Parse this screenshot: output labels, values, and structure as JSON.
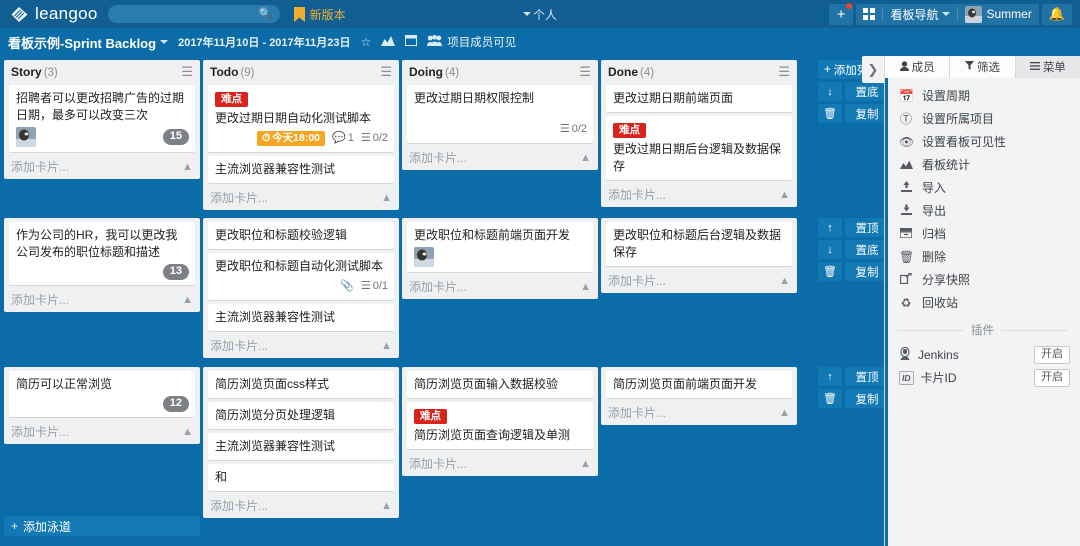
{
  "topbar": {
    "brand": "leangoo",
    "search_placeholder": "",
    "search_value": "",
    "new_version_label": "新版本",
    "center_tab": "个人",
    "add_label": "+",
    "nav_label": "看板导航",
    "user_name": "Summer",
    "bell_icon": "bell-icon"
  },
  "boardbar": {
    "title": "看板示例-Sprint Backlog",
    "dates": "2017年11月10日 - 2017年11月23日",
    "star_icon": "star-icon",
    "chart_icon": "chart-icon",
    "collapse_icon": "minimize-icon",
    "visibility_icon": "team-icon",
    "visibility": "项目成员可见"
  },
  "board": {
    "add_list_label": "添加列表",
    "add_lane_label": "添加泳道",
    "collapse_handle_icon": "chevron-right-icon",
    "rail": {
      "top_label": "置顶",
      "bottom_label": "置底",
      "copy_label": "复制",
      "up_icon": "arrow-up-icon",
      "down_icon": "arrow-down-icon",
      "trash_icon": "trash-icon"
    },
    "add_card_label": "添加卡片...",
    "columns": [
      {
        "title": "Story",
        "count": "(3)"
      },
      {
        "title": "Todo",
        "count": "(9)"
      },
      {
        "title": "Doing",
        "count": "(4)"
      },
      {
        "title": "Done",
        "count": "(4)"
      }
    ],
    "lanes": [
      {
        "columns": [
          {
            "cards": [
              {
                "text": "招聘者可以更改招聘广告的过期日期，最多可以改变三次",
                "avatar": true,
                "points": "15"
              }
            ]
          },
          {
            "cards": [
              {
                "tag": "难点",
                "text": "更改过期日期自动化测试脚本",
                "due": "今天18:00",
                "comments": "1",
                "checklist": "0/2"
              },
              {
                "text": "主流浏览器兼容性测试"
              }
            ]
          },
          {
            "cards": [
              {
                "text": "更改过期日期权限控制",
                "checklist": "0/2"
              }
            ]
          },
          {
            "cards": [
              {
                "text": "更改过期日期前端页面"
              },
              {
                "tag": "难点",
                "text": "更改过期日期后台逻辑及数据保存"
              }
            ]
          }
        ]
      },
      {
        "columns": [
          {
            "cards": [
              {
                "text": "作为公司的HR，我可以更改我公司发布的职位标题和描述",
                "points": "13"
              }
            ]
          },
          {
            "cards": [
              {
                "text": "更改职位和标题校验逻辑"
              },
              {
                "text": "更改职位和标题自动化测试脚本",
                "attachment": true,
                "checklist": "0/1"
              },
              {
                "text": "主流浏览器兼容性测试"
              }
            ]
          },
          {
            "cards": [
              {
                "text": "更改职位和标题前端页面开发",
                "avatar": true
              }
            ]
          },
          {
            "cards": [
              {
                "text": "更改职位和标题后台逻辑及数据保存"
              }
            ]
          }
        ]
      },
      {
        "columns": [
          {
            "cards": [
              {
                "text": "简历可以正常浏览",
                "points": "12"
              }
            ]
          },
          {
            "cards": [
              {
                "text": "简历浏览页面css样式"
              },
              {
                "text": "简历浏览分页处理逻辑"
              },
              {
                "text": "主流浏览器兼容性测试"
              },
              {
                "text": "和"
              }
            ]
          },
          {
            "cards": [
              {
                "text": "简历浏览页面输入数据校验"
              },
              {
                "tag": "难点",
                "text": "简历浏览页面查询逻辑及单测"
              }
            ]
          },
          {
            "cards": [
              {
                "text": "简历浏览页面前端页面开发"
              }
            ]
          }
        ]
      }
    ]
  },
  "right_panel": {
    "tabs": [
      {
        "label": "成员",
        "icon": "user-icon"
      },
      {
        "label": "筛选",
        "icon": "filter-icon"
      },
      {
        "label": "菜单",
        "icon": "hamburger-icon"
      }
    ],
    "menu": [
      {
        "label": "设置周期",
        "icon": "calendar-icon"
      },
      {
        "label": "设置所属项目",
        "icon": "project-icon"
      },
      {
        "label": "设置看板可见性",
        "icon": "eye-icon"
      },
      {
        "label": "看板统计",
        "icon": "chart-icon"
      },
      {
        "label": "导入",
        "icon": "import-icon"
      },
      {
        "label": "导出",
        "icon": "export-icon"
      },
      {
        "label": "归档",
        "icon": "archive-icon"
      },
      {
        "label": "删除",
        "icon": "trash-icon"
      },
      {
        "label": "分享快照",
        "icon": "share-icon"
      },
      {
        "label": "回收站",
        "icon": "recycle-icon"
      }
    ],
    "plugins_title": "插件",
    "plugins": [
      {
        "name": "Jenkins",
        "icon": "jenkins-icon",
        "action": "开启"
      },
      {
        "name": "卡片ID",
        "icon": "id-icon",
        "action": "开启"
      }
    ]
  },
  "colors": {
    "brand_blue": "#0b6ca8",
    "header_blue": "#115f92",
    "tag_red": "#d9241d",
    "due_orange": "#f5a623",
    "accent_yellow": "#f0ad2e"
  }
}
